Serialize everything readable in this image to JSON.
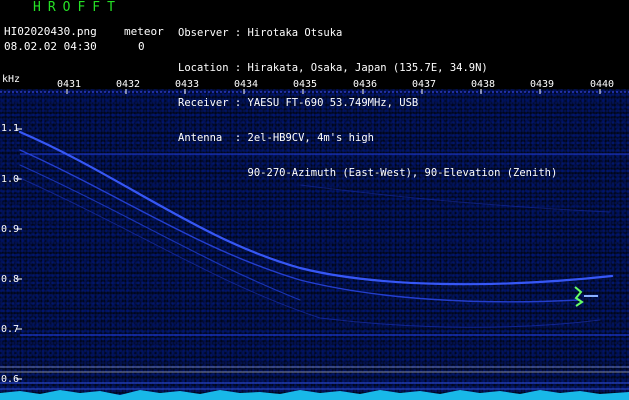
{
  "header": {
    "app_title": "HROFFT",
    "file_name": "HI02020430.png",
    "meteor_label": "meteor",
    "datetime": "08.02.02 04:30",
    "meteor_count": "0"
  },
  "meta_rows": [
    "Observer : Hirotaka Otsuka",
    "Location : Hirakata, Osaka, Japan (135.7E, 34.9N)",
    "Receiver : YAESU FT-690 53.749MHz, USB",
    "Antenna  : 2el-HB9CV, 4m's high",
    "           90-270-Azimuth (East-West), 90-Elevation (Zenith)"
  ],
  "axes": {
    "unit": "kHz",
    "time_ticks": [
      "0431",
      "0432",
      "0433",
      "0434",
      "0435",
      "0436",
      "0437",
      "0438",
      "0439",
      "0440"
    ],
    "freq_ticks": [
      "1.1",
      "1.0",
      "0.9",
      "0.8",
      "0.7",
      "0.6"
    ]
  },
  "colors": {
    "background": "#000000",
    "title_green": "#25e025",
    "trace_blue": "#3a5cff",
    "line_blue": "#2440ff",
    "highlight": "#66ff66"
  }
}
